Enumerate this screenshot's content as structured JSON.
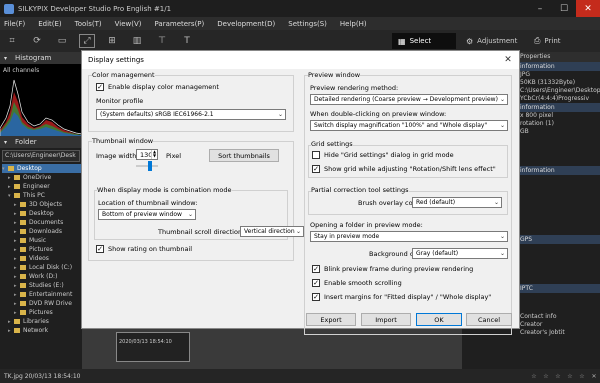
{
  "app": {
    "title": "SILKYPIX Developer Studio Pro English  #1/1",
    "menu": [
      "File(F)",
      "Edit(E)",
      "Tools(T)",
      "View(V)",
      "Parameters(P)",
      "Development(D)",
      "Settings(S)",
      "Help(H)"
    ],
    "modes": {
      "select": "Select",
      "adjustment": "Adjustment",
      "print": "Print"
    },
    "histogram": {
      "header": "Histogram",
      "channel_label": "All channels"
    },
    "folder": {
      "header": "Folder",
      "path": "C:\\Users\\Engineer\\Desk",
      "tree": [
        {
          "label": "Desktop",
          "selected": true
        },
        {
          "label": "OneDrive"
        },
        {
          "label": "Engineer"
        },
        {
          "label": "This PC"
        },
        {
          "label": "3D Objects"
        },
        {
          "label": "Desktop"
        },
        {
          "label": "Documents"
        },
        {
          "label": "Downloads"
        },
        {
          "label": "Music"
        },
        {
          "label": "Pictures"
        },
        {
          "label": "Videos"
        },
        {
          "label": "Local Disk (C:)"
        },
        {
          "label": "Work (D:)"
        },
        {
          "label": "Studies (E:)"
        },
        {
          "label": "Entertainment"
        },
        {
          "label": "DVD RW Drive"
        },
        {
          "label": "Pictures"
        },
        {
          "label": "Libraries"
        },
        {
          "label": "Network"
        }
      ]
    },
    "thumbnail": {
      "name": "TK.jpg",
      "date": "2020/03/13 18:54:10"
    },
    "properties": {
      "header": "Properties",
      "rows": [
        {
          "kind": "sec",
          "text": "information"
        },
        {
          "kind": "row",
          "text": "JPG"
        },
        {
          "kind": "row",
          "text": "50KB (31332Byte)"
        },
        {
          "kind": "row",
          "text": "C:\\Users\\Engineer\\Desktop"
        },
        {
          "kind": "row",
          "text": "YCbCr(4:4:4)Progressiv"
        },
        {
          "kind": "sec",
          "text": "information"
        },
        {
          "kind": "row",
          "text": "x 800 pixel"
        },
        {
          "kind": "row",
          "text": "rotation (1)"
        },
        {
          "kind": "row",
          "text": "GB"
        },
        {
          "kind": "sec",
          "text": "information"
        },
        {
          "kind": "sec",
          "text": "GPS"
        },
        {
          "kind": "sec",
          "text": "IPTC"
        },
        {
          "kind": "row",
          "text": "Contact info"
        },
        {
          "kind": "row",
          "text": "Creator"
        },
        {
          "kind": "row",
          "text": "Creator's Jobtit"
        }
      ]
    },
    "status": {
      "text": "TK.jpg 20/03/13 18:54:10"
    }
  },
  "dialog": {
    "title": "Display settings",
    "color_management": {
      "group_label": "Color management",
      "enable_label": "Enable display color management",
      "enable_checked": true,
      "monitor_profile_label": "Monitor profile",
      "monitor_profile_value": "(System defaults) sRGB IEC61966-2.1"
    },
    "thumbnail_window": {
      "group_label": "Thumbnail window",
      "image_width_label": "Image width:",
      "image_width_value": "130",
      "pixel_label": "Pixel",
      "sort_button": "Sort thumbnails",
      "combination_label": "When display mode is combination mode",
      "location_label": "Location of thumbnail window:",
      "location_value": "Bottom of preview window",
      "scroll_label": "Thumbnail scroll direction:",
      "scroll_value": "Vertical direction",
      "rating_label": "Show rating on thumbnail",
      "rating_checked": true
    },
    "preview_window": {
      "group_label": "Preview window",
      "rendering_method_label": "Preview rendering method:",
      "rendering_method_value": "Detailed rendering (Coarse preview → Development preview)",
      "double_click_label": "When double-clicking on preview window:",
      "double_click_value": "Switch display magnification \"100%\" and \"Whole display\""
    },
    "grid_settings": {
      "group_label": "Grid settings",
      "hide_dialog_label": "Hide \"Grid settings\" dialog in grid mode",
      "hide_dialog_checked": false,
      "show_grid_label": "Show grid while adjusting \"Rotation/Shift lens effect\"",
      "show_grid_checked": true
    },
    "partial_correction": {
      "group_label": "Partial correction tool settings",
      "brush_label": "Brush overlay color",
      "brush_value": "Red (default)"
    },
    "folder_opening": {
      "label": "Opening a folder in preview mode:",
      "value": "Stay in preview mode",
      "background_label": "Background color",
      "background_value": "Gray (default)",
      "blink_label": "Blink preview frame during preview rendering",
      "blink_checked": true,
      "smooth_label": "Enable smooth scrolling",
      "smooth_checked": true,
      "margins_label": "Insert margins for \"Fitted display\" / \"Whole display\"",
      "margins_checked": true
    },
    "buttons": {
      "export": "Export",
      "import": "Import",
      "ok": "OK",
      "cancel": "Cancel"
    }
  }
}
